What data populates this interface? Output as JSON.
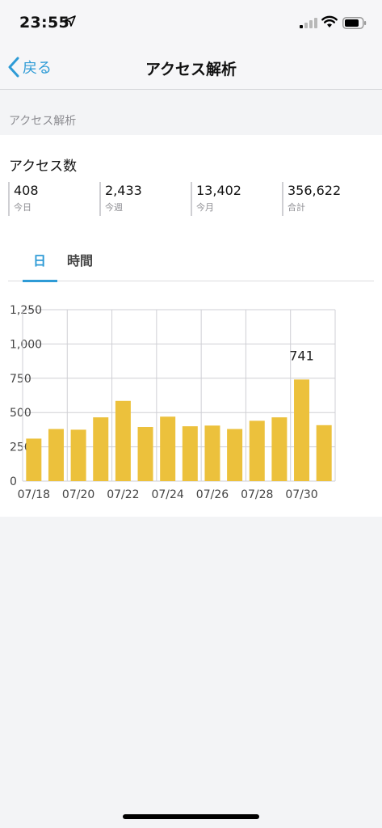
{
  "status_bar": {
    "time": "23:55",
    "icons": [
      "location-arrow-icon",
      "cell-signal-icon",
      "wifi-icon",
      "battery-icon"
    ]
  },
  "nav": {
    "back_label": "戻る",
    "title": "アクセス解析"
  },
  "section_header": "アクセス解析",
  "access": {
    "title": "アクセス数",
    "stats": [
      {
        "value": "408",
        "label": "今日"
      },
      {
        "value": "2,433",
        "label": "今週"
      },
      {
        "value": "13,402",
        "label": "今月"
      },
      {
        "value": "356,622",
        "label": "合計"
      }
    ]
  },
  "tabs": {
    "day": "日",
    "hour": "時間",
    "active": "day"
  },
  "colors": {
    "accent": "#2e9bd6",
    "bar": "#ecc13c",
    "background": "#f3f4f6"
  },
  "chart_data": {
    "type": "bar",
    "categories": [
      "07/18",
      "07/19",
      "07/20",
      "07/21",
      "07/22",
      "07/23",
      "07/24",
      "07/25",
      "07/26",
      "07/27",
      "07/28",
      "07/29",
      "07/30",
      "07/31"
    ],
    "values": [
      310,
      380,
      375,
      465,
      585,
      395,
      470,
      400,
      405,
      380,
      440,
      465,
      741,
      408
    ],
    "x_tick_labels": [
      "07/18",
      "07/20",
      "07/22",
      "07/24",
      "07/26",
      "07/28",
      "07/30"
    ],
    "y_tick_labels": [
      "0",
      "250",
      "500",
      "750",
      "1,000",
      "1,250"
    ],
    "ylim": [
      0,
      1250
    ],
    "grid": true,
    "annotation": {
      "index": 12,
      "text": "741"
    }
  }
}
